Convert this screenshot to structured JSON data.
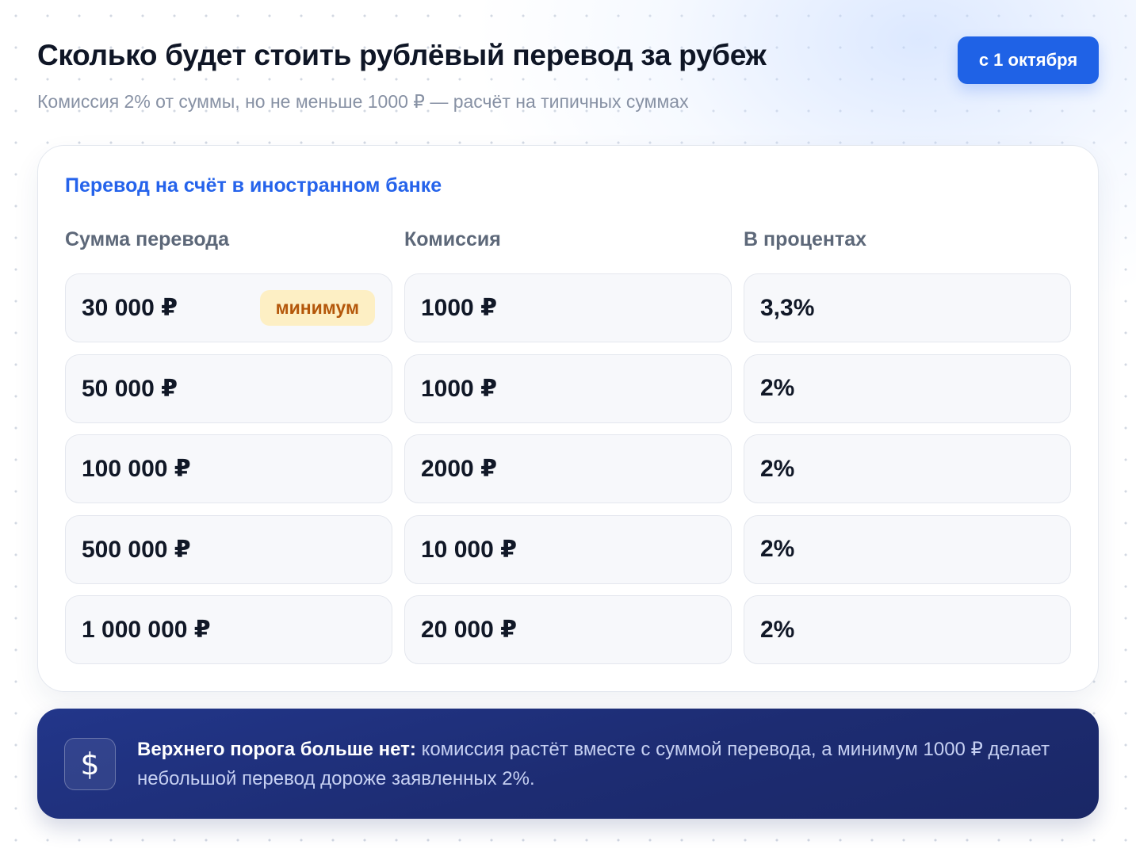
{
  "header": {
    "title": "Сколько будет стоить рублёвый перевод за рубеж",
    "subtitle": "Комиссия 2% от суммы, но не меньше 1000 ₽ — расчёт на типичных суммах",
    "badge": "с 1 октября"
  },
  "table": {
    "section_title": "Перевод на счёт в иностранном банке",
    "columns": [
      "Сумма перевода",
      "Комиссия",
      "В процентах"
    ],
    "rows": [
      {
        "amount": "30 000 ₽",
        "tag": "минимум",
        "commission": "1000 ₽",
        "percent": "3,3%"
      },
      {
        "amount": "50 000 ₽",
        "commission": "1000 ₽",
        "percent": "2%"
      },
      {
        "amount": "100 000 ₽",
        "commission": "2000 ₽",
        "percent": "2%"
      },
      {
        "amount": "500 000 ₽",
        "commission": "10 000 ₽",
        "percent": "2%"
      },
      {
        "amount": "1 000 000 ₽",
        "commission": "20 000 ₽",
        "percent": "2%"
      }
    ]
  },
  "note": {
    "icon": "dollar-icon",
    "icon_glyph": "$",
    "lead": "Верхнего порога больше нет:",
    "text": "комиссия растёт вместе с суммой перевода, а минимум 1000 ₽ делает небольшой перевод дороже заявленных 2%."
  },
  "colors": {
    "accent": "#2563eb",
    "badge": "#1f62e6",
    "tag_background": "#fdefc4",
    "tag_text": "#b4570a",
    "banner": "#1d2c72"
  }
}
